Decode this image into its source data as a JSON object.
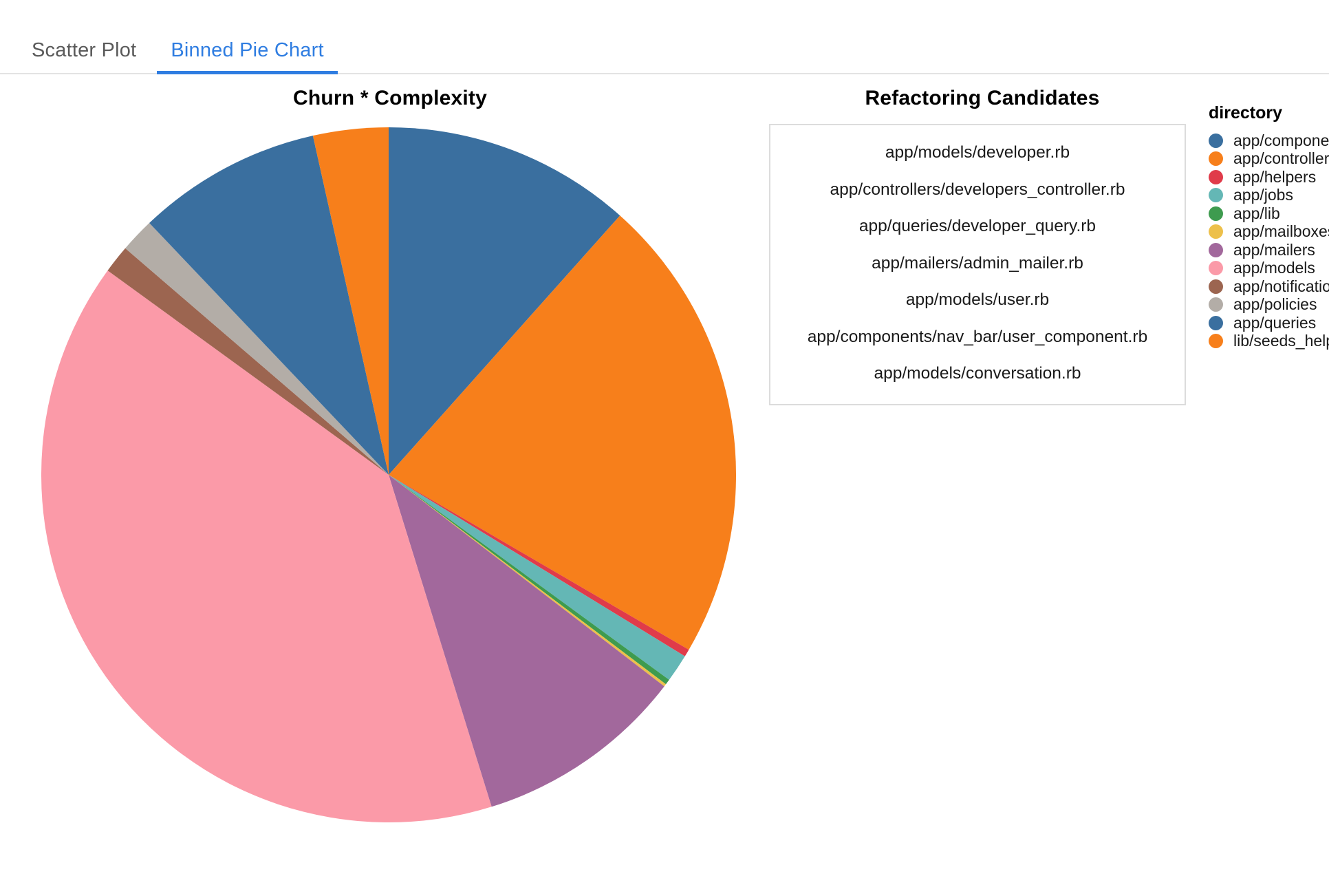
{
  "tabs": [
    {
      "label": "Scatter Plot",
      "active": false
    },
    {
      "label": "Binned Pie Chart",
      "active": true
    }
  ],
  "theme": {
    "accent": "#2f7de1",
    "tab_inactive": "#5a5a5a",
    "border": "#e3e3e3",
    "box_border": "#dcdcdc"
  },
  "pie": {
    "title": "Churn * Complexity"
  },
  "candidates": {
    "title": "Refactoring Candidates",
    "items": [
      "app/models/developer.rb",
      "app/controllers/developers_controller.rb",
      "app/queries/developer_query.rb",
      "app/mailers/admin_mailer.rb",
      "app/models/user.rb",
      "app/components/nav_bar/user_component.rb",
      "app/models/conversation.rb"
    ]
  },
  "legend": {
    "title": "directory",
    "items": [
      {
        "label": "app/components",
        "color": "#3a6f9f"
      },
      {
        "label": "app/controllers",
        "color": "#f77f1b"
      },
      {
        "label": "app/helpers",
        "color": "#e03b4a"
      },
      {
        "label": "app/jobs",
        "color": "#64b7b5"
      },
      {
        "label": "app/lib",
        "color": "#3e9b4f"
      },
      {
        "label": "app/mailboxes",
        "color": "#eec martins"
      },
      {
        "label": "app/mailers",
        "color": "#a濃"
      },
      {
        "label": "app/models",
        "color": "#fb9aa8"
      },
      {
        "label": "app/notifications",
        "color": "#9c6550"
      },
      {
        "label": "app/policies",
        "color": "#b3ada7"
      },
      {
        "label": "app/queries",
        "color": "#3a6f9f"
      },
      {
        "label": "lib/seeds_helper",
        "color": "#f77f1b"
      }
    ]
  },
  "chart_data": {
    "type": "pie",
    "title": "Churn * Complexity",
    "legend_title": "directory",
    "legend_position": "right",
    "start_angle_deg": 0,
    "direction": "clockwise",
    "categories": [
      "app/components",
      "app/controllers",
      "app/helpers",
      "app/jobs",
      "app/lib",
      "app/mailboxes",
      "app/mailers",
      "app/models",
      "app/notifications",
      "app/policies",
      "app/queries",
      "lib/seeds_helper"
    ],
    "values": [
      11.6,
      21.8,
      0.35,
      1.3,
      0.25,
      0.12,
      9.8,
      39.8,
      1.3,
      1.6,
      8.6,
      3.5
    ],
    "unit": "percent",
    "colors": [
      "#3a6f9f",
      "#f77f1b",
      "#e03b4a",
      "#64b7b5",
      "#3e9b4f",
      "#edc04b",
      "#a2689c",
      "#fb9aa8",
      "#9c6550",
      "#b3ada7",
      "#3a6f9f",
      "#f77f1b"
    ]
  }
}
